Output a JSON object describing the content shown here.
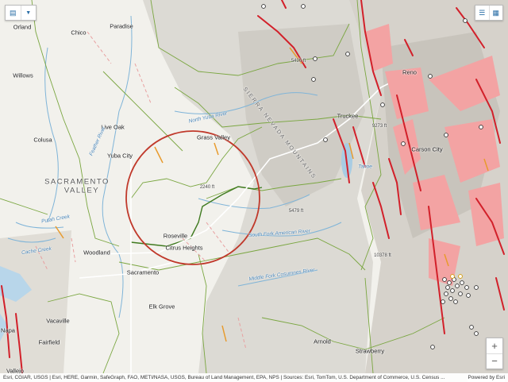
{
  "controls": {
    "layers_icon": "layers-icon",
    "dropdown_icon": "chevron-down-icon",
    "legend_icon": "legend-icon",
    "basemap_icon": "basemap-grid-icon",
    "zoom_in": "+",
    "zoom_out": "−"
  },
  "cities": {
    "orland": "Orland",
    "chico": "Chico",
    "paradise": "Paradise",
    "willows": "Willows",
    "live_oak": "Live Oak",
    "colusa": "Colusa",
    "yuba_city": "Yuba City",
    "grass_valley": "Grass Valley",
    "truckee": "Truckee",
    "reno": "Reno",
    "carson_city": "Carson City",
    "roseville": "Roseville",
    "citrus_heights": "Citrus Heights",
    "woodland": "Woodland",
    "sacramento": "Sacramento",
    "elk_grove": "Elk Grove",
    "vacaville": "Vacaville",
    "fairfield": "Fairfield",
    "napa": "Napa",
    "vallejo": "Vallejo",
    "arnold": "Arnold",
    "strawberry": "Strawberry"
  },
  "regions": {
    "sacramento_valley_1": "SACRAMENTO",
    "sacramento_valley_2": "VALLEY",
    "sierra_nevada": "SIERRA NEVADA MOUNTAINS"
  },
  "water": {
    "tahoe": "Tahoe",
    "cache_creek": "Cache Creek",
    "feather_river": "Feather River",
    "putah_creek": "Putah Creek",
    "south_fork_american": "South Fork American River",
    "middle_fork_cosumnes": "Middle Fork Cosumnes River",
    "north_yuba": "North Yuba River"
  },
  "elevations": {
    "e1": "5496 ft",
    "e2": "2240 ft",
    "e3": "5479 ft",
    "e4": "10378 ft",
    "e5": "9273 ft"
  },
  "attribution": {
    "text": "Esri, CGIAR, USGS | Esri, HERE, Garmin, SafeGraph, FAO, METI/NASA, USGS, Bureau of Land Management, EPA, NPS | Sources: Esri, TomTom, U.S. Department of Commerce, U.S. Census ...",
    "powered": "Powered by Esri"
  },
  "colors": {
    "fault_red": "#d2202a",
    "fault_orange": "#e89a2c",
    "hazard_pink": "#f08a8a",
    "boundary_green": "#6a9a3a",
    "circle": "#c0392b"
  }
}
